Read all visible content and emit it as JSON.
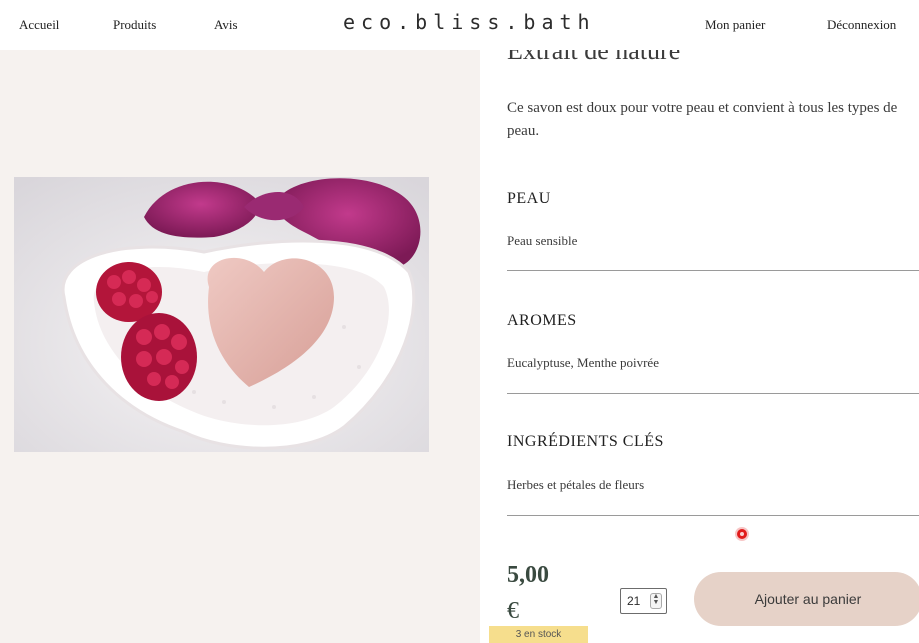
{
  "nav": {
    "home": "Accueil",
    "products": "Produits",
    "reviews": "Avis",
    "cart": "Mon panier",
    "logout": "Déconnexion"
  },
  "brand": "eco.bliss.bath",
  "product": {
    "title": "Extrait de nature",
    "description": "Ce savon est doux pour votre peau et convient à tous les types de peau.",
    "sections": [
      {
        "heading": "PEAU",
        "value": "Peau sensible"
      },
      {
        "heading": "AROMES",
        "value": "Eucalyptuse, Menthe poivrée"
      },
      {
        "heading": "INGRÉDIENTS CLÉS",
        "value": "Herbes et pétales de fleurs"
      }
    ],
    "price": "5,00",
    "currency": "€",
    "quantity": "21",
    "add_to_cart": "Ajouter au panier",
    "stock": "3 en stock"
  },
  "colors": {
    "panel_bg": "#f6f2ef",
    "button_bg": "#e6d2c8",
    "stock_badge": "#f6de8d"
  }
}
